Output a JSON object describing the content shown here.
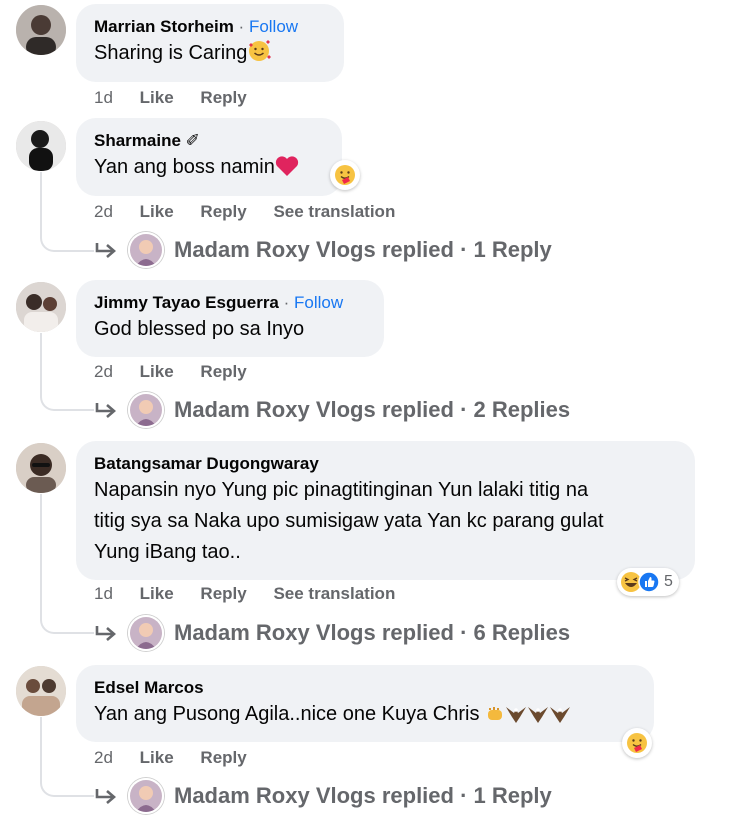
{
  "comments": [
    {
      "author": "Marrian Storheim",
      "follow_label": "Follow",
      "text": "Sharing is Caring",
      "time": "1d",
      "like_label": "Like",
      "reply_label": "Reply"
    },
    {
      "author": "Sharmaine",
      "text": "Yan ang boss namin",
      "time": "2d",
      "like_label": "Like",
      "reply_label": "Reply",
      "translate_label": "See translation",
      "replies_summary": "Madam Roxy Vlogs replied · 1 Reply"
    },
    {
      "author": "Jimmy Tayao Esguerra",
      "follow_label": "Follow",
      "text": "God blessed po sa Inyo",
      "time": "2d",
      "like_label": "Like",
      "reply_label": "Reply",
      "replies_summary": "Madam Roxy Vlogs replied · 2 Replies"
    },
    {
      "author": "Batangsamar Dugongwaray",
      "text": "Napansin nyo Yung pic pinagtitinginan Yun lalaki titig na\ntitig sya sa Naka upo sumisigaw yata Yan kc parang gulat\nYung iBang tao..",
      "time": "1d",
      "like_label": "Like",
      "reply_label": "Reply",
      "translate_label": "See translation",
      "reaction_count": "5",
      "replies_summary": "Madam Roxy Vlogs replied · 6 Replies"
    },
    {
      "author": "Edsel Marcos",
      "text": "Yan ang Pusong Agila..nice one Kuya Chris",
      "time": "2d",
      "like_label": "Like",
      "reply_label": "Reply",
      "replies_summary": "Madam Roxy Vlogs replied · 1 Reply"
    }
  ],
  "colors": {
    "bubble": "#f0f2f5",
    "link": "#1877f2",
    "muted": "#65676b",
    "heart": "#f02849"
  }
}
